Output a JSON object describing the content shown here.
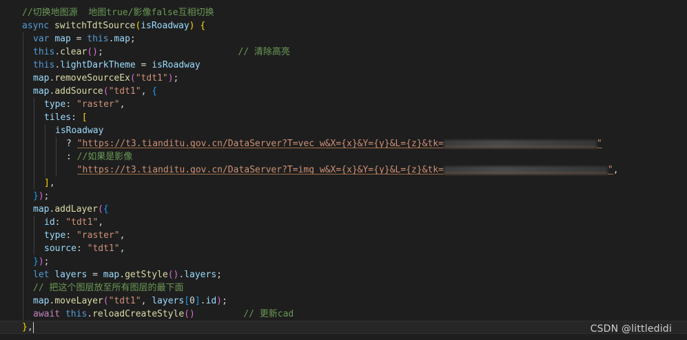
{
  "editor": {
    "language": "javascript",
    "theme": {
      "background": "#1e1e1e",
      "keyword": "#569cd6",
      "control": "#c586c0",
      "function": "#dcdcaa",
      "variable": "#9cdcfe",
      "string": "#ce9178",
      "comment": "#6a9955",
      "bracket_level_1": "#ffd700",
      "bracket_level_2": "#da70d6",
      "bracket_level_3": "#179fff"
    },
    "lines": [
      {
        "indent": 1,
        "tokens": [
          {
            "t": "//切换地图源  地图true/影像false互相切换",
            "c": "cm"
          }
        ]
      },
      {
        "indent": 1,
        "tokens": [
          {
            "t": "async",
            "c": "kw"
          },
          {
            "t": " ",
            "c": "pun"
          },
          {
            "t": "switchTdtSource",
            "c": "fn"
          },
          {
            "t": "(",
            "c": "b1"
          },
          {
            "t": "isRoadway",
            "c": "var"
          },
          {
            "t": ")",
            "c": "b1"
          },
          {
            "t": " ",
            "c": "pun"
          },
          {
            "t": "{",
            "c": "b1"
          }
        ]
      },
      {
        "indent": 2,
        "tokens": [
          {
            "t": "var",
            "c": "kw"
          },
          {
            "t": " ",
            "c": "pun"
          },
          {
            "t": "map",
            "c": "var"
          },
          {
            "t": " = ",
            "c": "pun"
          },
          {
            "t": "this",
            "c": "kw"
          },
          {
            "t": ".",
            "c": "pun"
          },
          {
            "t": "map",
            "c": "var"
          },
          {
            "t": ";",
            "c": "pun"
          }
        ]
      },
      {
        "indent": 2,
        "tokens": [
          {
            "t": "this",
            "c": "kw"
          },
          {
            "t": ".",
            "c": "pun"
          },
          {
            "t": "clear",
            "c": "fn"
          },
          {
            "t": "()",
            "c": "b2"
          },
          {
            "t": ";",
            "c": "pun"
          },
          {
            "t": "                         ",
            "c": "pun"
          },
          {
            "t": "// 清除高亮",
            "c": "cm"
          }
        ]
      },
      {
        "indent": 2,
        "tokens": [
          {
            "t": "this",
            "c": "kw"
          },
          {
            "t": ".",
            "c": "pun"
          },
          {
            "t": "lightDarkTheme",
            "c": "var"
          },
          {
            "t": " = ",
            "c": "pun"
          },
          {
            "t": "isRoadway",
            "c": "var"
          }
        ]
      },
      {
        "indent": 2,
        "tokens": [
          {
            "t": "map",
            "c": "var"
          },
          {
            "t": ".",
            "c": "pun"
          },
          {
            "t": "removeSourceEx",
            "c": "fn"
          },
          {
            "t": "(",
            "c": "b2"
          },
          {
            "t": "\"tdt1\"",
            "c": "str"
          },
          {
            "t": ")",
            "c": "b2"
          },
          {
            "t": ";",
            "c": "pun"
          }
        ]
      },
      {
        "indent": 2,
        "tokens": [
          {
            "t": "map",
            "c": "var"
          },
          {
            "t": ".",
            "c": "pun"
          },
          {
            "t": "addSource",
            "c": "fn"
          },
          {
            "t": "(",
            "c": "b2"
          },
          {
            "t": "\"tdt1\"",
            "c": "str"
          },
          {
            "t": ", ",
            "c": "pun"
          },
          {
            "t": "{",
            "c": "b3"
          }
        ]
      },
      {
        "indent": 3,
        "tokens": [
          {
            "t": "type",
            "c": "var"
          },
          {
            "t": ": ",
            "c": "pun"
          },
          {
            "t": "\"raster\"",
            "c": "str"
          },
          {
            "t": ",",
            "c": "pun"
          }
        ]
      },
      {
        "indent": 3,
        "tokens": [
          {
            "t": "tiles",
            "c": "var"
          },
          {
            "t": ": ",
            "c": "pun"
          },
          {
            "t": "[",
            "c": "b1"
          }
        ]
      },
      {
        "indent": 4,
        "tokens": [
          {
            "t": "isRoadway",
            "c": "var"
          }
        ]
      },
      {
        "indent": 5,
        "tokens": [
          {
            "t": "? ",
            "c": "pun"
          },
          {
            "t": "\"https://t3.tianditu.gov.cn/DataServer?T=vec_w&X={x}&Y={y}&L={z}&tk=",
            "c": "str",
            "hl": true
          },
          {
            "r": 222,
            "hl": true
          },
          {
            "t": "\"",
            "c": "str",
            "hl": true
          }
        ]
      },
      {
        "indent": 5,
        "tokens": [
          {
            "t": ": ",
            "c": "pun"
          },
          {
            "t": "//如果是影像",
            "c": "cm"
          }
        ]
      },
      {
        "indent": 5,
        "tokens": [
          {
            "t": "  ",
            "c": "pun"
          },
          {
            "t": "\"https://t3.tianditu.gov.cn/DataServer?T=img_w&X={x}&Y={y}&L={z}&tk=",
            "c": "str",
            "hl": true
          },
          {
            "r": 238,
            "hl": true
          },
          {
            "t": "\"",
            "c": "str",
            "hl": true
          },
          {
            "t": ",",
            "c": "pun"
          }
        ]
      },
      {
        "indent": 3,
        "tokens": [
          {
            "t": "]",
            "c": "b1"
          },
          {
            "t": ",",
            "c": "pun"
          }
        ]
      },
      {
        "indent": 2,
        "tokens": [
          {
            "t": "}",
            "c": "b3"
          },
          {
            "t": ")",
            "c": "b2"
          },
          {
            "t": ";",
            "c": "pun"
          }
        ]
      },
      {
        "indent": 2,
        "tokens": [
          {
            "t": "map",
            "c": "var"
          },
          {
            "t": ".",
            "c": "pun"
          },
          {
            "t": "addLayer",
            "c": "fn"
          },
          {
            "t": "(",
            "c": "b2"
          },
          {
            "t": "{",
            "c": "b3"
          }
        ]
      },
      {
        "indent": 3,
        "tokens": [
          {
            "t": "id",
            "c": "var"
          },
          {
            "t": ": ",
            "c": "pun"
          },
          {
            "t": "\"tdt1\"",
            "c": "str"
          },
          {
            "t": ",",
            "c": "pun"
          }
        ]
      },
      {
        "indent": 3,
        "tokens": [
          {
            "t": "type",
            "c": "var"
          },
          {
            "t": ": ",
            "c": "pun"
          },
          {
            "t": "\"raster\"",
            "c": "str"
          },
          {
            "t": ",",
            "c": "pun"
          }
        ]
      },
      {
        "indent": 3,
        "tokens": [
          {
            "t": "source",
            "c": "var"
          },
          {
            "t": ": ",
            "c": "pun"
          },
          {
            "t": "\"tdt1\"",
            "c": "str"
          },
          {
            "t": ",",
            "c": "pun"
          }
        ]
      },
      {
        "indent": 2,
        "tokens": [
          {
            "t": "}",
            "c": "b3"
          },
          {
            "t": ")",
            "c": "b2"
          },
          {
            "t": ";",
            "c": "pun"
          }
        ]
      },
      {
        "indent": 2,
        "tokens": [
          {
            "t": "let",
            "c": "kw"
          },
          {
            "t": " ",
            "c": "pun"
          },
          {
            "t": "layers",
            "c": "var"
          },
          {
            "t": " = ",
            "c": "pun"
          },
          {
            "t": "map",
            "c": "var"
          },
          {
            "t": ".",
            "c": "pun"
          },
          {
            "t": "getStyle",
            "c": "fn"
          },
          {
            "t": "()",
            "c": "b2"
          },
          {
            "t": ".",
            "c": "pun"
          },
          {
            "t": "layers",
            "c": "var"
          },
          {
            "t": ";",
            "c": "pun"
          }
        ]
      },
      {
        "indent": 2,
        "tokens": [
          {
            "t": "// 把这个图层放至所有图层的最下面",
            "c": "cm"
          }
        ]
      },
      {
        "indent": 2,
        "tokens": [
          {
            "t": "map",
            "c": "var"
          },
          {
            "t": ".",
            "c": "pun"
          },
          {
            "t": "moveLayer",
            "c": "fn"
          },
          {
            "t": "(",
            "c": "b2"
          },
          {
            "t": "\"tdt1\"",
            "c": "str"
          },
          {
            "t": ", ",
            "c": "pun"
          },
          {
            "t": "layers",
            "c": "var"
          },
          {
            "t": "[",
            "c": "b3"
          },
          {
            "t": "0",
            "c": "pun"
          },
          {
            "t": "]",
            "c": "b3"
          },
          {
            "t": ".",
            "c": "pun"
          },
          {
            "t": "id",
            "c": "var"
          },
          {
            "t": ")",
            "c": "b2"
          },
          {
            "t": ";",
            "c": "pun"
          }
        ]
      },
      {
        "indent": 2,
        "tokens": [
          {
            "t": "await",
            "c": "ctl"
          },
          {
            "t": " ",
            "c": "pun"
          },
          {
            "t": "this",
            "c": "kw"
          },
          {
            "t": ".",
            "c": "pun"
          },
          {
            "t": "reloadCreateStyle",
            "c": "fn"
          },
          {
            "t": "()",
            "c": "b2"
          },
          {
            "t": "         ",
            "c": "pun"
          },
          {
            "t": "// 更新cad",
            "c": "cm"
          }
        ]
      },
      {
        "indent": 1,
        "current": true,
        "cursor": true,
        "tokens": [
          {
            "t": "}",
            "c": "b1"
          },
          {
            "t": ",",
            "c": "pun"
          }
        ]
      }
    ]
  },
  "watermark": "CSDN @littledidi"
}
